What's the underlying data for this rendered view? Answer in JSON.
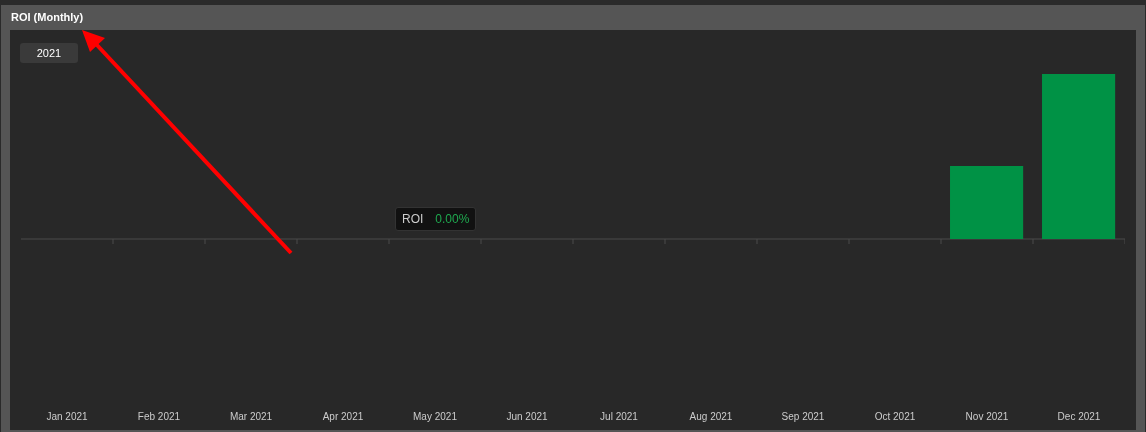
{
  "panel": {
    "title": "ROI (Monthly)"
  },
  "year_button": {
    "label": "2021"
  },
  "tooltip": {
    "label": "ROI",
    "value": "0.00%"
  },
  "months": [
    "Jan 2021",
    "Feb 2021",
    "Mar 2021",
    "Apr 2021",
    "May 2021",
    "Jun 2021",
    "Jul 2021",
    "Aug 2021",
    "Sep 2021",
    "Oct 2021",
    "Nov 2021",
    "Dec 2021"
  ]
}
